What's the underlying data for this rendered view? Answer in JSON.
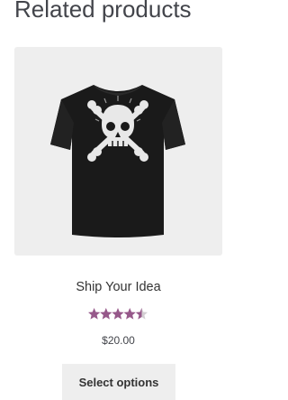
{
  "section": {
    "title": "Related products"
  },
  "product": {
    "name": "Ship Your Idea",
    "price": "$20.00",
    "rating": 4.5,
    "rating_max": 5,
    "button_label": "Select options",
    "image_icon": "skull-crossbones-tshirt"
  },
  "colors": {
    "star_filled": "#96588a",
    "star_empty": "#d3ced2",
    "image_bg": "#eeeeee",
    "shirt": "#1a1a1a",
    "button_bg": "#eeeeee"
  }
}
